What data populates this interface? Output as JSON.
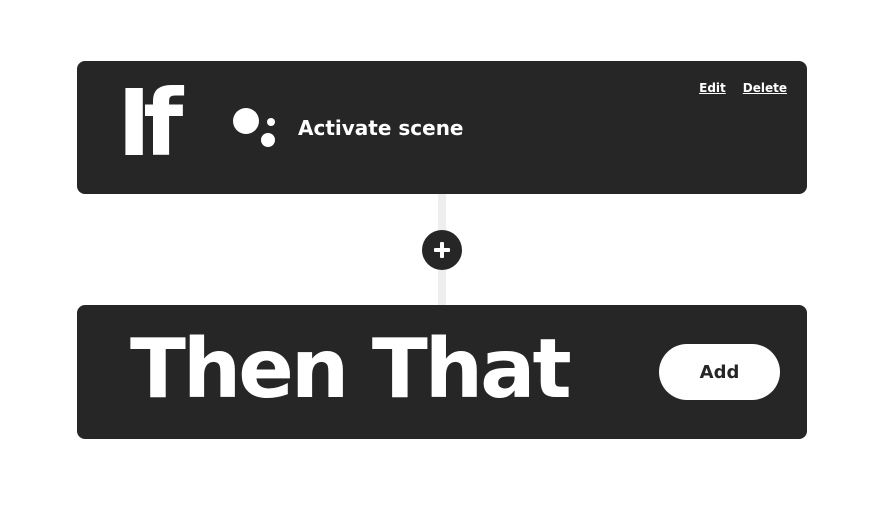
{
  "trigger": {
    "keyword": "If",
    "icon": "google-assistant-icon",
    "label": "Activate scene",
    "edit_label": "Edit",
    "delete_label": "Delete"
  },
  "connector": {
    "add_icon": "plus-icon"
  },
  "action": {
    "keyword": "Then That",
    "add_label": "Add"
  },
  "colors": {
    "card_background": "#262626",
    "text": "#ffffff",
    "connector": "#eeeeee"
  }
}
